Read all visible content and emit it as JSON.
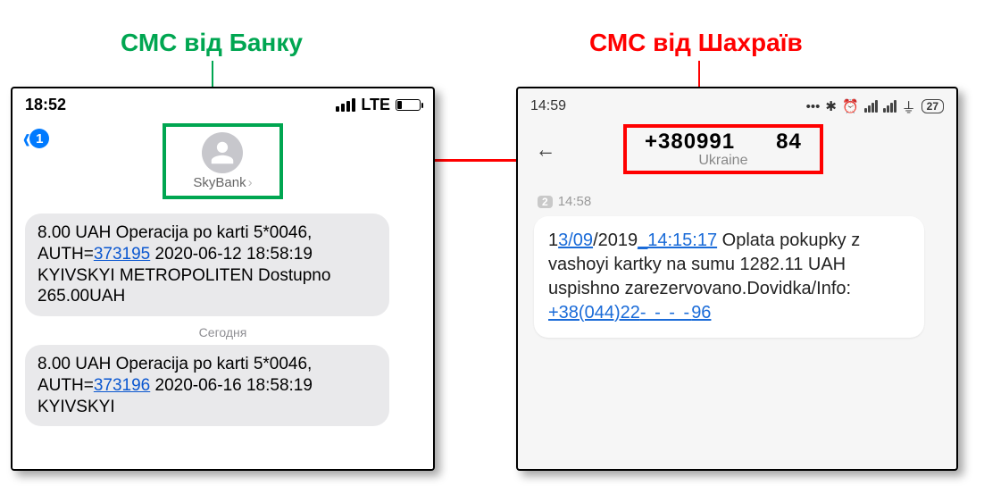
{
  "labels": {
    "bank": "СМС від Банку",
    "fraud": "СМС від Шахраїв"
  },
  "bank_phone": {
    "status": {
      "time": "18:52",
      "net": "LTE"
    },
    "back_badge": "1",
    "sender": "SkyBank",
    "messages": [
      {
        "pre": "8.00 UAH Operacija po karti 5*0046, AUTH=",
        "auth": "373195",
        "post": " 2020-06-12 18:58:19 KYIVSKYI METROPOLITEN Dostupno 265.00UAH"
      },
      {
        "pre": "8.00 UAH Operacija po karti 5*0046, AUTH=",
        "auth": "373196",
        "post": " 2020-06-16 18:58:19 KYIVSKYI"
      }
    ],
    "separator": "Сегодня"
  },
  "fraud_phone": {
    "status": {
      "time": "14:59",
      "battery": "27"
    },
    "sender_prefix": "+380991",
    "sender_suffix": "84",
    "sender_country": "Ukraine",
    "thread_badge": "2",
    "thread_time": "14:58",
    "message": {
      "p1": "1",
      "link1": "3/09",
      "p2": "/2019",
      "link2": "_14:15:17",
      "p3": " Oplata pokupky z vashoyi kartky na sumu 1282.11 UAH uspishno zarezervovano.Dovidka/Info: ",
      "phone_link_pre": "+38(044)22",
      "phone_link_mask": "- - - -",
      "phone_link_post": "96"
    }
  }
}
